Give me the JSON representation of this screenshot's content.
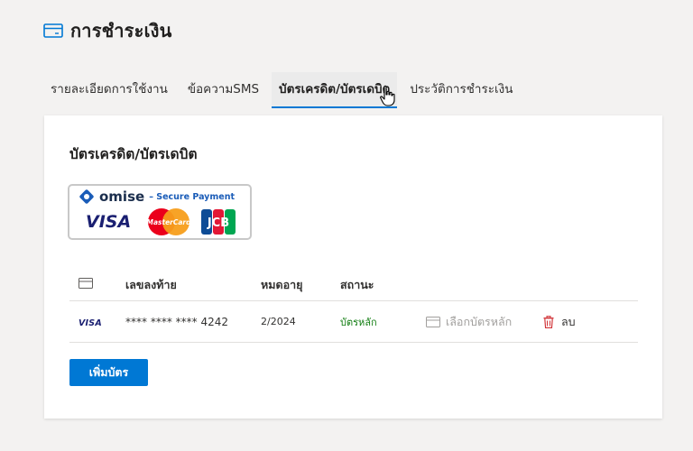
{
  "page": {
    "title": "การชำระเงิน",
    "icon": "credit-card-icon"
  },
  "tabs": [
    {
      "label": "รายละเอียดการใช้งาน"
    },
    {
      "label": "ข้อความSMS"
    },
    {
      "label": "บัตรเครดิต/บัตรเดบิต",
      "active": true
    },
    {
      "label": "ประวัติการชำระเงิน"
    }
  ],
  "card": {
    "title": "บัตรเครดิต/บัตรเดบิต",
    "badge": {
      "brand": "omise",
      "secure_text": "– Secure Payment",
      "logos": [
        "VISA",
        "MasterCard",
        "JCB"
      ]
    },
    "table": {
      "headers": {
        "icon": "card-icon",
        "last_digits": "เลขลงท้าย",
        "expiry": "หมดอายุ",
        "status": "สถานะ"
      },
      "rows": [
        {
          "brand": "VISA",
          "number": "**** **** **** 4242",
          "expiry": "2/2024",
          "status": "บัตรหลัก",
          "set_primary_label": "เลือกบัตรหลัก",
          "delete_label": "ลบ"
        }
      ]
    },
    "add_button_label": "เพิ่มบัตร"
  },
  "colors": {
    "accent": "#0078d4",
    "status_ok": "#107c10",
    "danger": "#d13438"
  }
}
